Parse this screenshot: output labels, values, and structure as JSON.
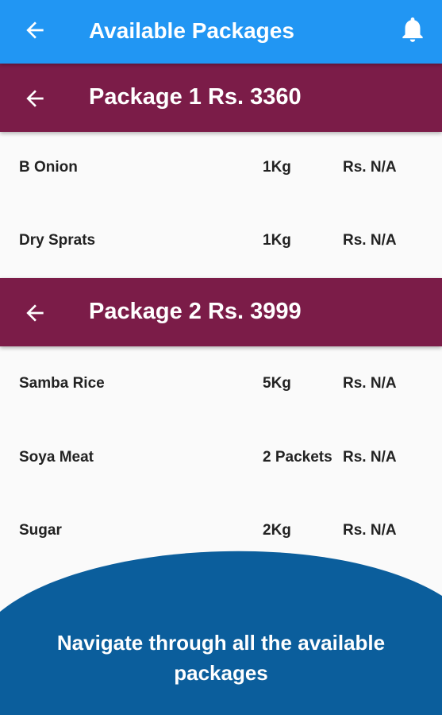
{
  "appbar": {
    "title": "Available Packages",
    "back_icon": "arrow-left-icon",
    "bell_icon": "bell-icon"
  },
  "packages": [
    {
      "title": "Package 1 Rs. 3360",
      "items": [
        {
          "name": "B Onion",
          "qty": "1Kg",
          "price": "Rs. N/A"
        },
        {
          "name": "Dry Sprats",
          "qty": "1Kg",
          "price": "Rs. N/A"
        }
      ]
    },
    {
      "title": "Package 2 Rs. 3999",
      "items": [
        {
          "name": "Samba Rice",
          "qty": "5Kg",
          "price": "Rs. N/A"
        },
        {
          "name": "Soya Meat",
          "qty": "2 Packets",
          "price": "Rs. N/A"
        },
        {
          "name": "Sugar",
          "qty": "2Kg",
          "price": "Rs. N/A"
        }
      ]
    }
  ],
  "overlay": {
    "caption": "Navigate through all the available packages"
  },
  "colors": {
    "appbar": "#2196f3",
    "package_header": "#7b1c48",
    "overlay": "#0b5e9c"
  }
}
